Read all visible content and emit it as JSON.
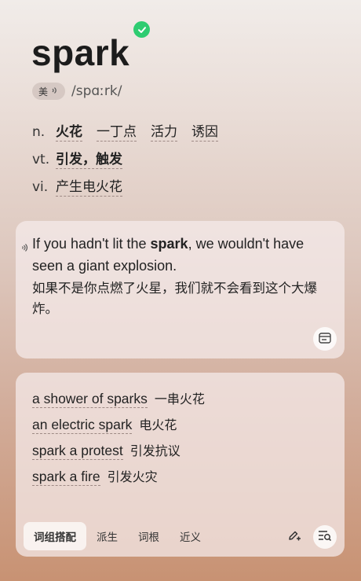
{
  "word": "spark",
  "pronunciation": {
    "badge_label": "美",
    "phonetic": "/spɑːrk/"
  },
  "definitions": [
    {
      "pos": "n.",
      "meanings": [
        "火花",
        "一丁点",
        "活力",
        "诱因"
      ]
    },
    {
      "pos": "vt.",
      "meanings": [
        "引发，触发"
      ]
    },
    {
      "pos": "vi.",
      "meanings": [
        "产生电火花"
      ]
    }
  ],
  "example": {
    "en_before": "If you hadn't lit the ",
    "en_bold": "spark",
    "en_after": ", we wouldn't have seen a giant explosion.",
    "cn": "如果不是你点燃了火星，我们就不会看到这个大爆炸。"
  },
  "phrases": [
    {
      "en": "a shower of sparks",
      "cn": "一串火花"
    },
    {
      "en": "an electric spark",
      "cn": "电火花"
    },
    {
      "en": "spark a protest",
      "cn": "引发抗议"
    },
    {
      "en": "spark a fire",
      "cn": "引发火灾"
    }
  ],
  "tabs": [
    "词组搭配",
    "派生",
    "词根",
    "近义"
  ],
  "icons": {
    "verified": "check-circle-icon",
    "speaker": "speaker-icon",
    "card": "card-icon",
    "pen": "pen-add-icon",
    "list_search": "list-search-icon"
  },
  "colors": {
    "verified": "#2ecc71"
  }
}
